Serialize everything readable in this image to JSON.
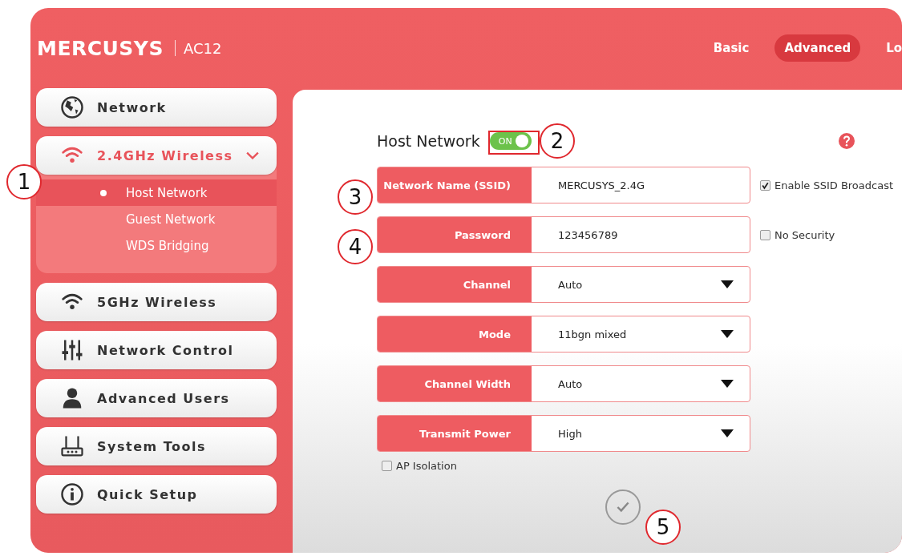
{
  "header": {
    "brand": "MERCUSYS",
    "model": "AC12",
    "nav": [
      {
        "label": "Basic",
        "selected": false
      },
      {
        "label": "Advanced",
        "selected": true
      },
      {
        "label": "Lo",
        "selected": false
      }
    ]
  },
  "sidebar": {
    "items": [
      {
        "label": "Network",
        "selected": false,
        "expanded": false
      },
      {
        "label": "2.4GHz Wireless",
        "selected": true,
        "expanded": true,
        "children": [
          {
            "label": "Host Network",
            "selected": true
          },
          {
            "label": "Guest Network",
            "selected": false
          },
          {
            "label": "WDS Bridging",
            "selected": false
          }
        ]
      },
      {
        "label": "5GHz Wireless",
        "selected": false,
        "expanded": false
      },
      {
        "label": "Network Control",
        "selected": false,
        "expanded": false
      },
      {
        "label": "Advanced Users",
        "selected": false,
        "expanded": false
      },
      {
        "label": "System Tools",
        "selected": false,
        "expanded": false
      },
      {
        "label": "Quick Setup",
        "selected": false,
        "expanded": false
      }
    ]
  },
  "host_network": {
    "title": "Host Network",
    "toggle": {
      "label": "ON",
      "on": true
    },
    "fields": [
      {
        "kind": "text",
        "label": "Network Name (SSID)",
        "value": "MERCUSYS_2.4G",
        "option": {
          "label": "Enable SSID Broadcast",
          "checked": true
        }
      },
      {
        "kind": "text",
        "label": "Password",
        "value": "123456789",
        "option": {
          "label": "No Security",
          "checked": false
        }
      },
      {
        "kind": "select",
        "label": "Channel",
        "value": "Auto"
      },
      {
        "kind": "select",
        "label": "Mode",
        "value": "11bgn mixed"
      },
      {
        "kind": "select",
        "label": "Channel Width",
        "value": "Auto"
      },
      {
        "kind": "select",
        "label": "Transmit Power",
        "value": "High"
      }
    ],
    "ap_isolation": {
      "label": "AP Isolation",
      "checked": false
    }
  },
  "callouts": [
    "1",
    "2",
    "3",
    "4",
    "5"
  ]
}
